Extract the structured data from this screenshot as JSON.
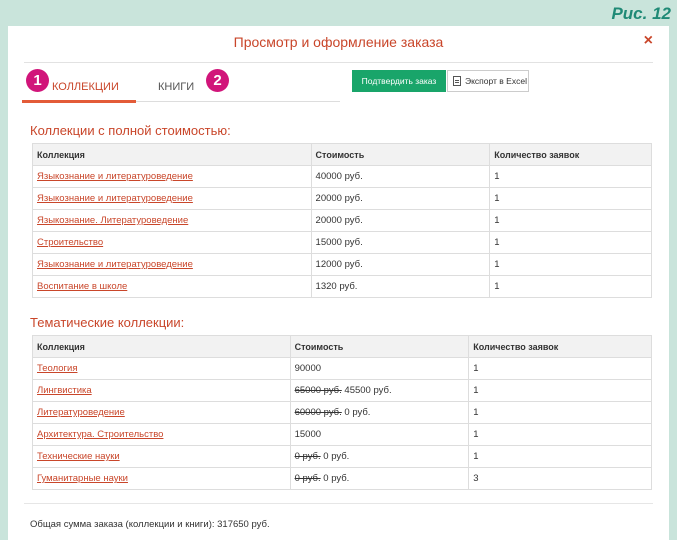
{
  "figure_label": "Рис. 12",
  "modal": {
    "title": "Просмотр и оформление заказа",
    "close": "×"
  },
  "tabs": [
    {
      "badge": "1",
      "label": "КОЛЛЕКЦИИ"
    },
    {
      "badge": "2",
      "label": "КНИГИ"
    }
  ],
  "toolbar": {
    "confirm_label": "Подтвердить заказ",
    "export_label": "Экспорт в Excel"
  },
  "full_collections": {
    "title": "Коллекции с полной стоимостью:",
    "headers": [
      "Коллекция",
      "Стоимость",
      "Количество заявок"
    ],
    "rows": [
      {
        "name": "Языкознание и литературоведение",
        "price": "40000 руб.",
        "count": "1"
      },
      {
        "name": "Языкознание и литературоведение",
        "price": "20000 руб.",
        "count": "1"
      },
      {
        "name": "Языкознание. Литературоведение",
        "price": "20000 руб.",
        "count": "1"
      },
      {
        "name": "Строительство",
        "price": "15000 руб.",
        "count": "1"
      },
      {
        "name": "Языкознание и литературоведение",
        "price": "12000 руб.",
        "count": "1"
      },
      {
        "name": "Воспитание в школе",
        "price": "1320 руб.",
        "count": "1"
      }
    ]
  },
  "thematic_collections": {
    "title": "Тематические коллекции:",
    "headers": [
      "Коллекция",
      "Стоимость",
      "Количество заявок"
    ],
    "rows": [
      {
        "name": "Теология",
        "old_price": "",
        "price": "90000",
        "count": "1"
      },
      {
        "name": "Лингвистика",
        "old_price": "65000 руб.",
        "price": "45500 руб.",
        "count": "1"
      },
      {
        "name": "Литературоведение",
        "old_price": "60000 руб.",
        "price": "0 руб.",
        "count": "1"
      },
      {
        "name": "Архитектура. Строительство",
        "old_price": "",
        "price": "15000",
        "count": "1"
      },
      {
        "name": "Технические науки",
        "old_price": "0 руб.",
        "price": "0 руб.",
        "count": "1"
      },
      {
        "name": "Гуманитарные науки",
        "old_price": "0 руб.",
        "price": "0 руб.",
        "count": "3"
      }
    ]
  },
  "total": "Общая сумма заказа (коллекции и книги): 317650 руб.",
  "colors": {
    "accent": "#c9462a",
    "confirm_button": "#19a56a",
    "badge": "#d1157a",
    "tab_underline": "#e35b38"
  }
}
